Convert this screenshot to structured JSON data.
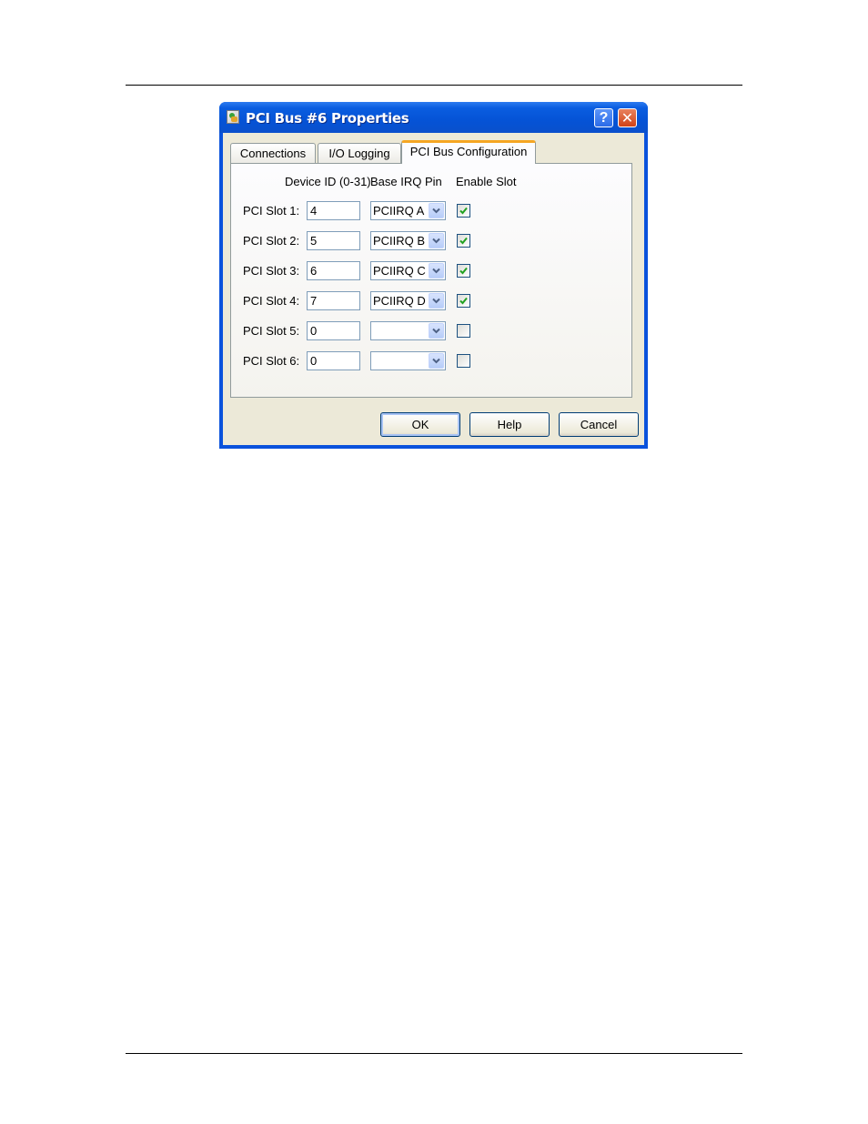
{
  "dialog": {
    "title": "PCI Bus #6 Properties",
    "title_icon": "app-properties-icon",
    "help_button": "?",
    "close_button": "✕"
  },
  "tabs": [
    {
      "label": "Connections",
      "active": false
    },
    {
      "label": "I/O Logging",
      "active": false
    },
    {
      "label": "PCI Bus Configuration",
      "active": true
    }
  ],
  "columns": {
    "device_id": "Device ID (0-31)",
    "base_irq": "Base IRQ Pin",
    "enable": "Enable Slot"
  },
  "slots": [
    {
      "label": "PCI Slot 1:",
      "device_id": "4",
      "irq": "PCIIRQ A",
      "enabled": true
    },
    {
      "label": "PCI Slot 2:",
      "device_id": "5",
      "irq": "PCIIRQ B",
      "enabled": true
    },
    {
      "label": "PCI Slot 3:",
      "device_id": "6",
      "irq": "PCIIRQ C",
      "enabled": true
    },
    {
      "label": "PCI Slot 4:",
      "device_id": "7",
      "irq": "PCIIRQ D",
      "enabled": true
    },
    {
      "label": "PCI Slot 5:",
      "device_id": "0",
      "irq": "",
      "enabled": false
    },
    {
      "label": "PCI Slot 6:",
      "device_id": "0",
      "irq": "",
      "enabled": false
    }
  ],
  "buttons": {
    "ok": "OK",
    "help": "Help",
    "cancel": "Cancel"
  },
  "colors": {
    "titlebar": "#0553d6",
    "active_tab_accent": "#f5a623",
    "check": "#21a121"
  }
}
